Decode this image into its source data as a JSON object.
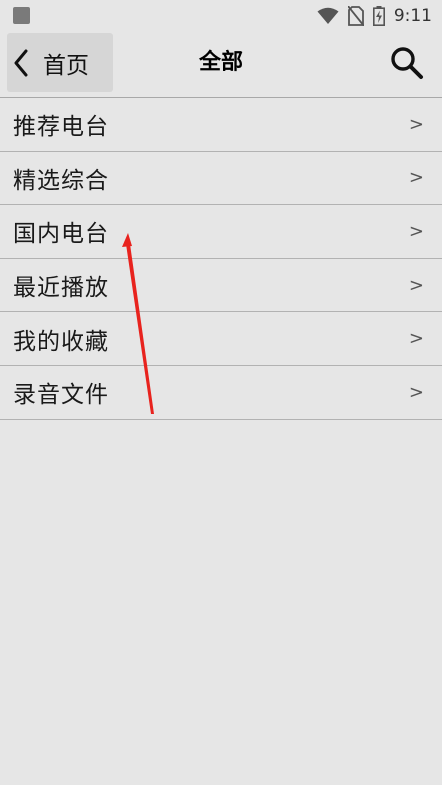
{
  "status_bar": {
    "time": "9:11",
    "icons": [
      "app-notification-icon",
      "wifi-icon",
      "no-sim-icon",
      "battery-charging-icon"
    ]
  },
  "toolbar": {
    "back_label": "首页",
    "title": "全部",
    "back_icon": "chevron-left-icon",
    "search_icon": "search-icon"
  },
  "menu": {
    "items": [
      {
        "label": "推荐电台",
        "arrow": ">"
      },
      {
        "label": "精选综合",
        "arrow": ">"
      },
      {
        "label": "国内电台",
        "arrow": ">"
      },
      {
        "label": "最近播放",
        "arrow": ">"
      },
      {
        "label": "我的收藏",
        "arrow": ">"
      },
      {
        "label": "录音文件",
        "arrow": ">"
      }
    ]
  },
  "colors": {
    "background": "#e6e6e6",
    "annotation": "#e8231e"
  }
}
